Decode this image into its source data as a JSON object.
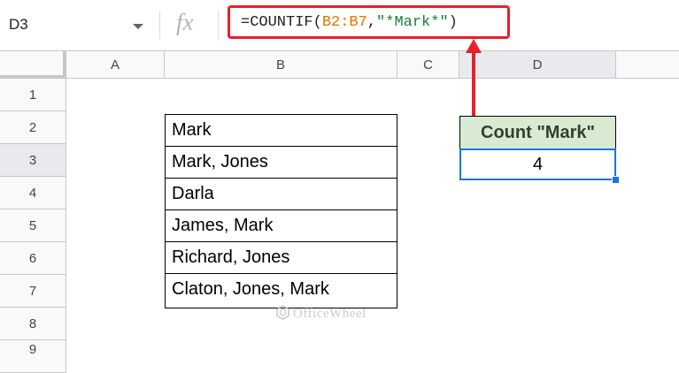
{
  "name_box": {
    "value": "D3"
  },
  "formula_bar": {
    "fx_label": "fx",
    "parts": [
      "=COUNTIF(",
      "B2:B7",
      ",",
      "\"*Mark*\"",
      ")"
    ]
  },
  "columns": [
    "A",
    "B",
    "C",
    "D"
  ],
  "rows": [
    "1",
    "2",
    "3",
    "4",
    "5",
    "6",
    "7",
    "8",
    "9"
  ],
  "table_b": [
    "Mark",
    "Mark, Jones",
    "Darla",
    "James, Mark",
    "Richard, Jones",
    "Claton, Jones, Mark"
  ],
  "result": {
    "header": "Count \"Mark\"",
    "value": "4"
  },
  "watermark": "OfficeWheel",
  "colors": {
    "highlight": "#e8202a",
    "selection": "#1a73e8",
    "header_fill": "#d9ead3"
  }
}
